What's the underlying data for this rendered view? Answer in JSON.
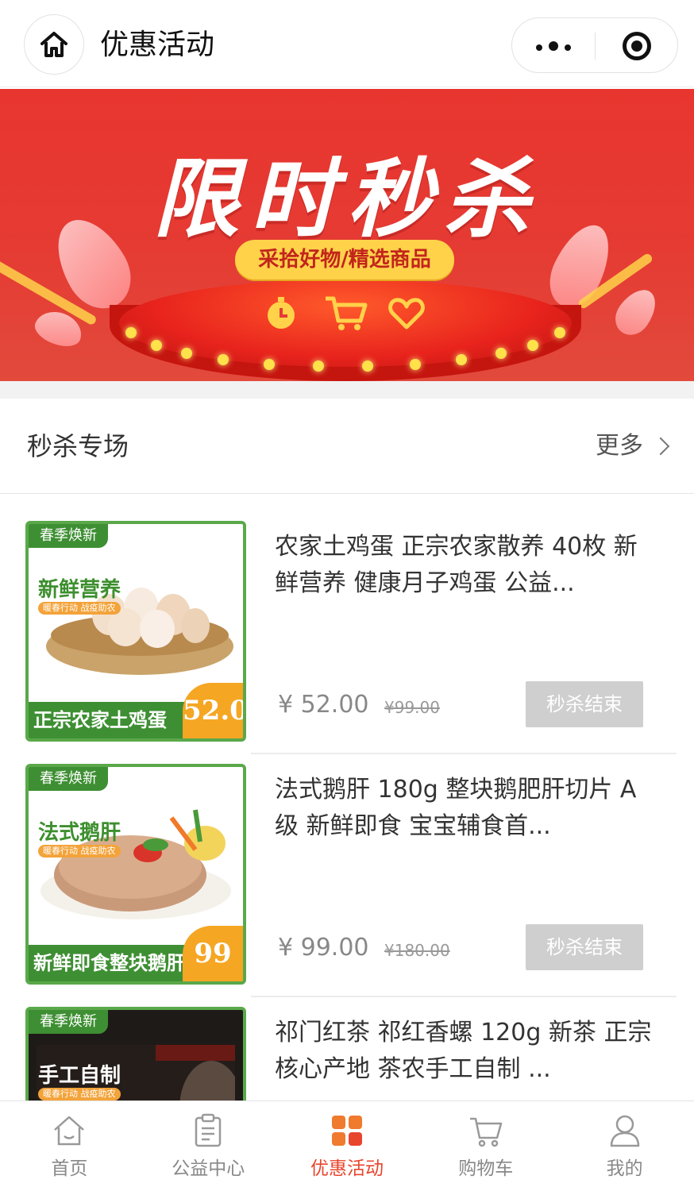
{
  "header": {
    "title": "优惠活动"
  },
  "banner": {
    "title": "限时秒杀",
    "subtitle": "采拾好物/精选商品"
  },
  "section": {
    "title": "秒杀专场",
    "more_label": "更多"
  },
  "products": [
    {
      "title": "农家土鸡蛋 正宗农家散养 40枚 新鲜营养 健康月子鸡蛋 公益...",
      "price": "¥ 52.00",
      "original_price": "¥99.00",
      "button": "秒杀结束",
      "image": {
        "tag": "春季焕新",
        "headline": "新鲜营养",
        "mini": "暖春行动 战疫助农",
        "bottom": "正宗农家土鸡蛋",
        "badge": "52.0"
      }
    },
    {
      "title": "法式鹅肝 180g 整块鹅肥肝切片 A级 新鲜即食 宝宝辅食首...",
      "price": "¥ 99.00",
      "original_price": "¥180.00",
      "button": "秒杀结束",
      "image": {
        "tag": "春季焕新",
        "headline": "法式鹅肝",
        "mini": "暖春行动 战疫助农",
        "bottom": "新鲜即食整块鹅肝",
        "badge": "99"
      }
    },
    {
      "title": "祁门红茶 祁红香螺 120g 新茶 正宗核心产地 茶农手工自制 ...",
      "image": {
        "tag": "春季焕新",
        "headline": "手工自制",
        "mini": "暖春行动 战疫助农"
      }
    }
  ],
  "tabbar": {
    "items": [
      {
        "label": "首页",
        "icon": "home-icon"
      },
      {
        "label": "公益中心",
        "icon": "clipboard-icon"
      },
      {
        "label": "优惠活动",
        "icon": "grid-icon",
        "active": true
      },
      {
        "label": "购物车",
        "icon": "cart-icon"
      },
      {
        "label": "我的",
        "icon": "person-icon"
      }
    ]
  },
  "colors": {
    "accent": "#e8452d",
    "banner_red": "#e53b33",
    "badge_orange": "#f5a623",
    "leaf_green": "#3e8f33",
    "disabled_button": "#cfcfcf"
  }
}
